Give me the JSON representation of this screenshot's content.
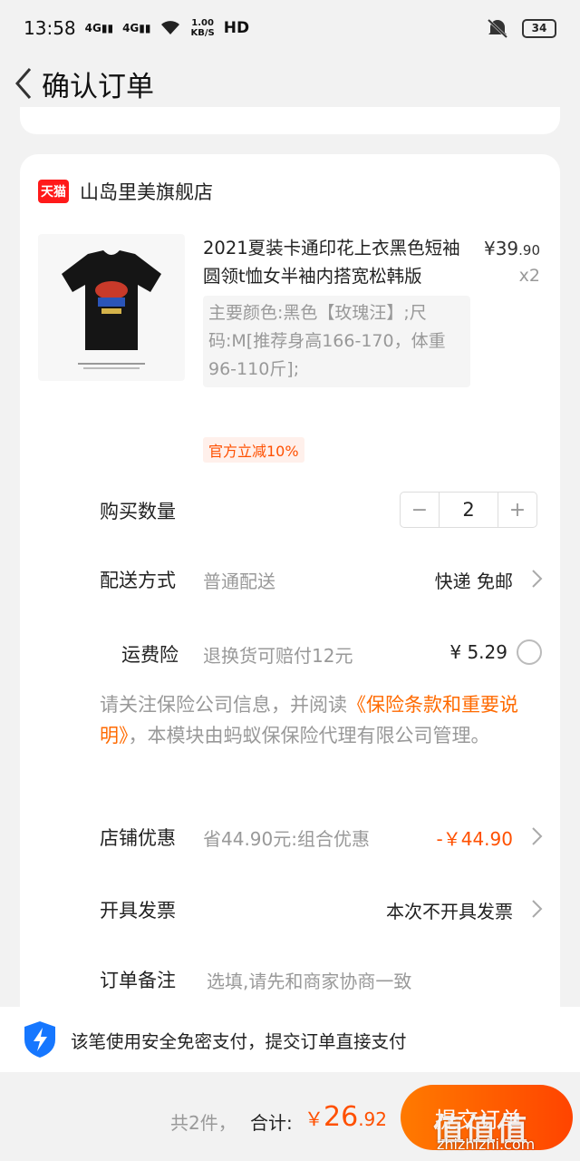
{
  "status_bar": {
    "time": "13:58",
    "net1": "4G",
    "net2": "4G",
    "speed_value": "1.00",
    "speed_unit": "KB/S",
    "hd": "HD",
    "battery": "34"
  },
  "nav": {
    "title": "确认订单"
  },
  "shop": {
    "badge": "天猫",
    "name": "山岛里美旗舰店"
  },
  "product": {
    "title": "2021夏装卡通印花上衣黑色短袖圆领t恤女半袖内搭宽松韩版",
    "price_symbol": "¥",
    "price_int": "39",
    "price_dec": ".90",
    "quantity": "x2",
    "sku": "主要颜色:黑色【玫瑰汪】;尺码:M[推荐身高166-170，体重96-110斤];",
    "promo_tag": "官方立减10%"
  },
  "rows": {
    "qty_label": "购买数量",
    "qty_value": "2",
    "minus": "−",
    "plus": "+",
    "delivery_label": "配送方式",
    "delivery_sub": "普通配送",
    "delivery_value": "快递 免邮",
    "insurance_label": "运费险",
    "insurance_sub": "退换货可赔付12元",
    "insurance_price": "¥ 5.29",
    "notice_pre": "请关注保险公司信息，并阅读",
    "notice_link": "《保险条款和重要说明》",
    "notice_post": "，本模块由蚂蚁保保险代理有限公司管理。",
    "discount_label": "店铺优惠",
    "discount_sub": "省44.90元:组合优惠",
    "discount_value": "-￥44.90",
    "invoice_label": "开具发票",
    "invoice_value": "本次不开具发票",
    "remark_label": "订单备注",
    "remark_placeholder": "选填,请先和商家协商一致"
  },
  "banner": {
    "text": "该笔使用安全免密支付，提交订单直接支付"
  },
  "footer": {
    "count": "共2件，",
    "total_label": "合计:",
    "currency": "￥",
    "total_int": "26",
    "total_dec": ".92",
    "submit": "提交订单"
  },
  "watermark": {
    "text": "值值值",
    "url": "zhizhizhi.com"
  },
  "colors": {
    "accent": "#ff5000",
    "tmall": "#ff1a1a"
  }
}
